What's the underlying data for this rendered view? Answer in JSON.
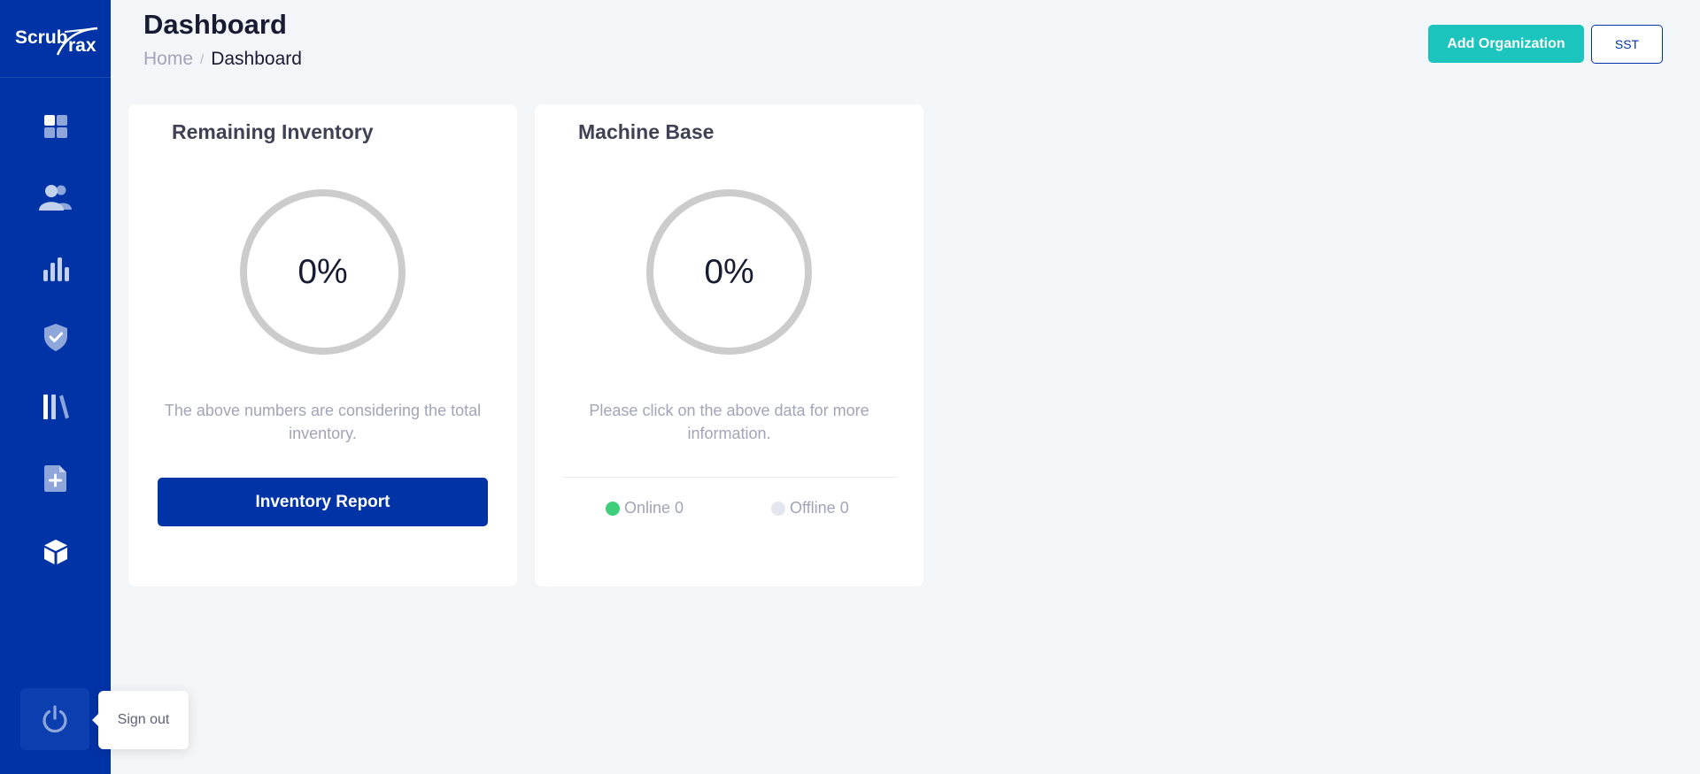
{
  "app": {
    "logo_text": "ScrubTrax"
  },
  "header": {
    "title": "Dashboard",
    "breadcrumb": {
      "home": "Home",
      "separator": "/",
      "current": "Dashboard"
    },
    "buttons": {
      "add_organization": "Add Organization",
      "sst": "SST"
    }
  },
  "sidebar": {
    "items": [
      {
        "icon": "dashboard-icon"
      },
      {
        "icon": "users-icon"
      },
      {
        "icon": "bar-chart-icon"
      },
      {
        "icon": "shield-check-icon"
      },
      {
        "icon": "library-icon"
      },
      {
        "icon": "file-plus-icon"
      },
      {
        "icon": "cube-icon"
      }
    ],
    "signout": {
      "icon": "power-icon",
      "tooltip": "Sign out"
    }
  },
  "cards": {
    "inventory": {
      "title": "Remaining Inventory",
      "value": "0%",
      "note": "The above numbers are considering the total inventory.",
      "button": "Inventory Report"
    },
    "machine": {
      "title": "Machine Base",
      "value": "0%",
      "note": "Please click on the above data for more information.",
      "online_label": "Online 0",
      "offline_label": "Offline 0"
    }
  },
  "colors": {
    "sidebar": "#0033a5",
    "accent_teal": "#1bc5bd",
    "primary": "#0033a5",
    "online": "#3ecf7a",
    "offline": "#e4e6ef",
    "ring": "#cccccc"
  }
}
